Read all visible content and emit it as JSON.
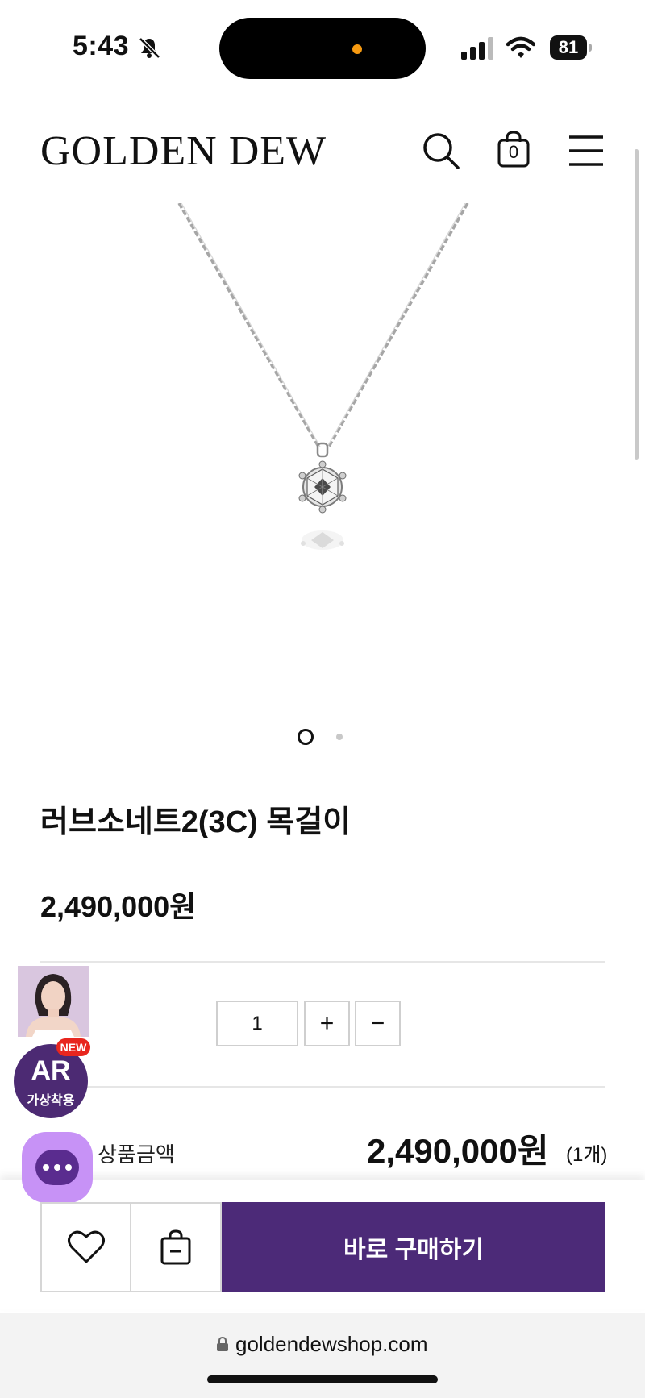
{
  "status_bar": {
    "time": "5:43",
    "battery": "81",
    "icons": [
      "bell-slash-icon",
      "signal-icon",
      "wifi-icon",
      "battery-icon"
    ]
  },
  "header": {
    "logo": "GOLDEN DEW",
    "cart_count": "0",
    "icons": [
      "search-icon",
      "shopping-bag-icon",
      "hamburger-menu-icon"
    ]
  },
  "gallery": {
    "slide_count": 2,
    "active_slide": 1
  },
  "product": {
    "name": "러브소네트2(3C) 목걸이",
    "price": "2,490,000원"
  },
  "quantity": {
    "value": "1",
    "plus": "+",
    "minus": "−"
  },
  "total": {
    "label": "총 상품금액",
    "price": "2,490,000원",
    "count": "(1개)"
  },
  "floating": {
    "ar_title": "AR",
    "ar_subtitle": "가상착용",
    "new_badge": "NEW",
    "chat_icon": "chat-bubble-icon"
  },
  "actions": {
    "wishlist_icon": "heart-icon",
    "cart_icon": "shopping-bag-minus-icon",
    "buy_label": "바로 구매하기"
  },
  "browser": {
    "url": "goldendewshop.com"
  },
  "colors": {
    "brand_purple": "#4c2a78",
    "chat_bg": "#c792f6",
    "new_badge": "#e8261e"
  }
}
